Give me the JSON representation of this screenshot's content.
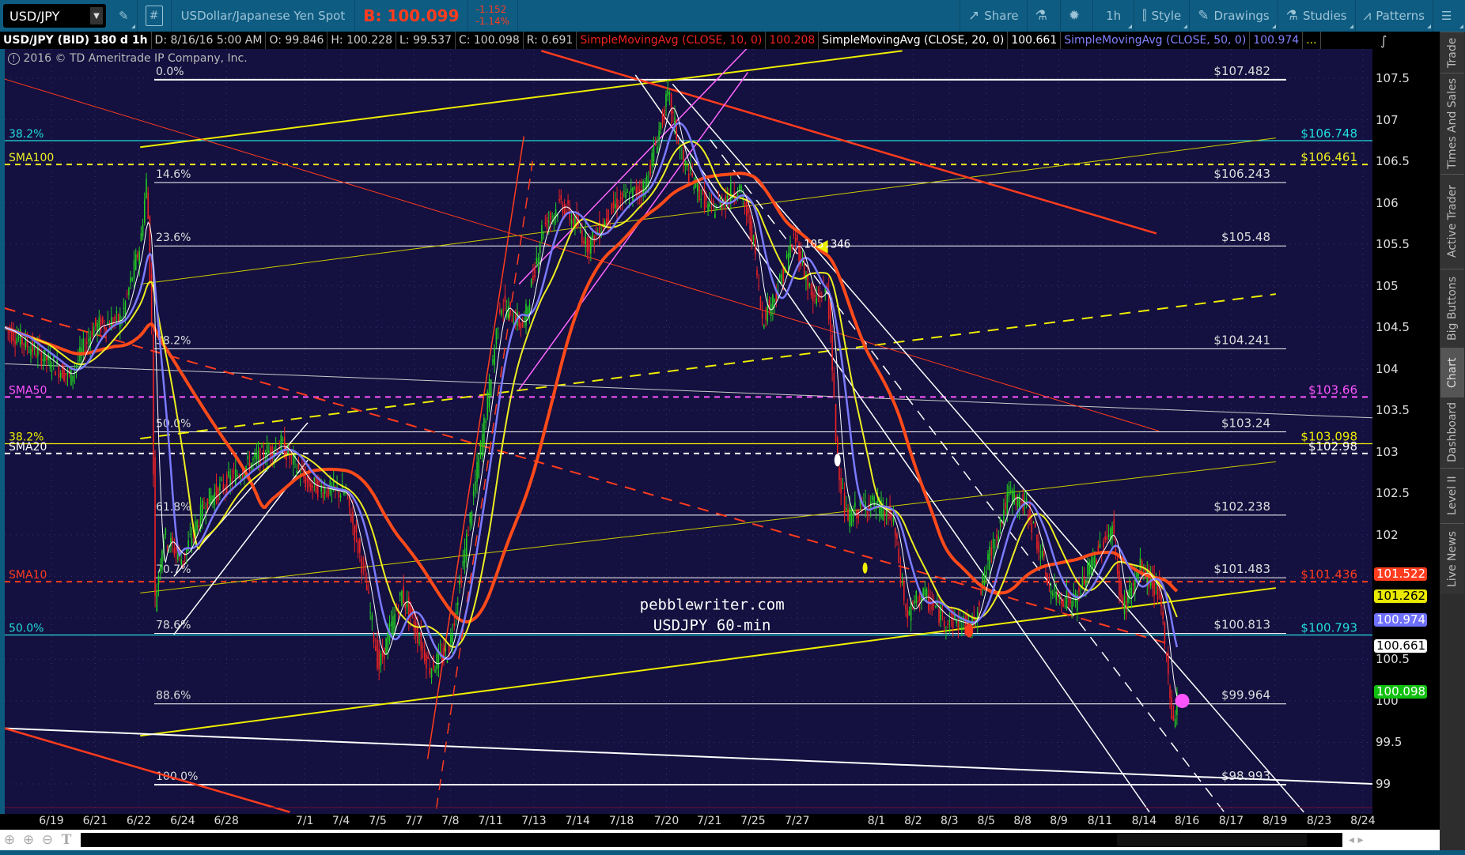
{
  "toolbar": {
    "symbol": "USD/JPY",
    "description": "USDollar/Japanese Yen Spot",
    "bid": "B: 100.099",
    "change": "-1.152",
    "change_pct": "-1.14%",
    "share": "Share",
    "interval": "1h",
    "style": "Style",
    "drawings": "Drawings",
    "studies": "Studies",
    "patterns": "Patterns"
  },
  "legend": {
    "title": "USD/JPY (BID) 180 d 1h",
    "date": "D: 8/16/16 5:00 AM",
    "open": "O: 99.846",
    "high": "H: 100.228",
    "low": "L: 99.537",
    "close": "C: 100.098",
    "range": "R: 0.691",
    "sma10": "SimpleMovingAvg (CLOSE, 10, 0)",
    "sma10_val": "100.208",
    "sma20": "SimpleMovingAvg (CLOSE, 20, 0)",
    "sma20_val": "100.661",
    "sma50": "SimpleMovingAvg (CLOSE, 50, 0)",
    "sma50_val": "100.974",
    "more": "..."
  },
  "copyright": "2016 © TD Ameritrade IP Company, Inc.",
  "annotations": {
    "site": "pebblewriter.com",
    "caption": "USDJPY 60-min",
    "peak_label": "105.346"
  },
  "sidebar_tabs": [
    "Trade",
    "Times And Sales",
    "Active Trader",
    "Big Buttons",
    "Chart",
    "Dashboard",
    "Level II",
    "Live News"
  ],
  "price_labels": [
    {
      "text": "101.522",
      "price": 101.52,
      "bg": "#ff3c1e",
      "fg": "#fff"
    },
    {
      "text": "101.262",
      "price": 101.26,
      "bg": "#e8e800",
      "fg": "#000"
    },
    {
      "text": "100.974",
      "price": 100.97,
      "bg": "#7070ff",
      "fg": "#fff"
    },
    {
      "text": "100.661",
      "price": 100.66,
      "bg": "#ffffff",
      "fg": "#000"
    },
    {
      "text": "100.098",
      "price": 100.1,
      "bg": "#10c010",
      "fg": "#fff"
    }
  ],
  "chart_data": {
    "type": "line",
    "y_ticks": [
      107.5,
      107,
      106.5,
      106,
      105.5,
      105,
      104.5,
      104,
      103.5,
      103,
      102.5,
      102,
      101.5,
      101,
      100.5,
      100,
      99.5,
      99
    ],
    "ylim": [
      98.66,
      107.85
    ],
    "x_ticks": [
      "6/19",
      "6/21",
      "6/22",
      "6/24",
      "6/28",
      "7/1",
      "7/4",
      "7/5",
      "7/7",
      "7/8",
      "7/11",
      "7/13",
      "7/14",
      "7/18",
      "7/20",
      "7/21",
      "7/25",
      "7/27",
      "8/1",
      "8/2",
      "8/3",
      "8/5",
      "8/8",
      "8/9",
      "8/11",
      "8/14",
      "8/16",
      "8/17",
      "8/19",
      "8/23",
      "8/24"
    ],
    "x_tick_pos": [
      0,
      1,
      2,
      3,
      4,
      5.79,
      6.62,
      7.46,
      8.29,
      9.12,
      10.04,
      11.03,
      12.03,
      13.03,
      14.06,
      15.04,
      16.04,
      17.05,
      18.86,
      19.7,
      20.53,
      21.37,
      22.2,
      23.03,
      23.97,
      24.98,
      25.96,
      26.97,
      27.97,
      28.98,
      29.98
    ],
    "price_series": [
      [
        -1.07,
        104.5
      ],
      [
        -0.32,
        104.2
      ],
      [
        0.43,
        103.9
      ],
      [
        0.96,
        104.5
      ],
      [
        1.6,
        104.6
      ],
      [
        2.03,
        105.5
      ],
      [
        2.18,
        106.3
      ],
      [
        2.29,
        104.5
      ],
      [
        2.37,
        101.2
      ],
      [
        2.56,
        102
      ],
      [
        2.99,
        101.7
      ],
      [
        3.53,
        102.4
      ],
      [
        4.38,
        102.8
      ],
      [
        5.24,
        103.1
      ],
      [
        5.88,
        102.6
      ],
      [
        6.73,
        102.5
      ],
      [
        7.16,
        101.5
      ],
      [
        7.48,
        100.4
      ],
      [
        8.01,
        101.3
      ],
      [
        8.65,
        100.4
      ],
      [
        9.08,
        100.6
      ],
      [
        9.51,
        102
      ],
      [
        9.94,
        103.5
      ],
      [
        10.26,
        104.8
      ],
      [
        10.79,
        104.5
      ],
      [
        11.22,
        105.7
      ],
      [
        11.65,
        106
      ],
      [
        12.29,
        105.5
      ],
      [
        12.93,
        106
      ],
      [
        13.57,
        106.2
      ],
      [
        14.1,
        107.3
      ],
      [
        14.42,
        106.5
      ],
      [
        15.06,
        105.9
      ],
      [
        15.71,
        106.2
      ],
      [
        16.03,
        105.6
      ],
      [
        16.24,
        104.6
      ],
      [
        16.56,
        104.9
      ],
      [
        16.99,
        105.6
      ],
      [
        17.41,
        104.8
      ],
      [
        17.74,
        105
      ],
      [
        17.95,
        103
      ],
      [
        18.16,
        102.2
      ],
      [
        18.7,
        102.4
      ],
      [
        19.23,
        102.2
      ],
      [
        19.55,
        101
      ],
      [
        19.87,
        101.3
      ],
      [
        20.41,
        101
      ],
      [
        21.05,
        100.9
      ],
      [
        21.47,
        101.8
      ],
      [
        21.9,
        102.5
      ],
      [
        22.33,
        102.3
      ],
      [
        22.86,
        101.3
      ],
      [
        23.4,
        101.2
      ],
      [
        23.82,
        101.7
      ],
      [
        24.25,
        102.1
      ],
      [
        24.47,
        101.1
      ],
      [
        24.89,
        101.6
      ],
      [
        25.32,
        101.3
      ],
      [
        25.53,
        100.3
      ],
      [
        25.64,
        99.7
      ],
      [
        25.75,
        100.1
      ]
    ],
    "fib_levels": [
      {
        "pct": "0.0%",
        "price": 107.482,
        "label": "$107.482"
      },
      {
        "pct": "14.6%",
        "price": 106.243,
        "label": "$106.243"
      },
      {
        "pct": "23.6%",
        "price": 105.48,
        "label": "$105.48"
      },
      {
        "pct": "38.2%",
        "price": 104.241,
        "label": "$104.241"
      },
      {
        "pct": "50.0%",
        "price": 103.24,
        "label": "$103.24"
      },
      {
        "pct": "61.8%",
        "price": 102.238,
        "label": "$102.238"
      },
      {
        "pct": "70.7%",
        "price": 101.483,
        "label": "$101.483"
      },
      {
        "pct": "78.6%",
        "price": 100.813,
        "label": "$100.813"
      },
      {
        "pct": "88.6%",
        "price": 99.964,
        "label": "$99.964"
      },
      {
        "pct": "100.0%",
        "price": 98.99,
        "label": "$98.993"
      }
    ],
    "levels": [
      {
        "name": "38.2%",
        "price": 106.748,
        "label": "$106.748",
        "color": "#22dddd",
        "dash": false
      },
      {
        "name": "SMA100",
        "price": 106.461,
        "label": "$106.461",
        "color": "#eeee22",
        "dash": true
      },
      {
        "name": "SMA50",
        "price": 103.66,
        "label": "$103.66",
        "color": "#ff55ff",
        "dash": true
      },
      {
        "name": "38.2%",
        "price": 103.098,
        "label": "$103.098",
        "color": "#eeee00",
        "dash": false
      },
      {
        "name": "SMA20",
        "price": 102.98,
        "label": "$102.98",
        "color": "#ffffff",
        "dash": true
      },
      {
        "name": "SMA10",
        "price": 101.436,
        "label": "$101.436",
        "color": "#ff3c1e",
        "dash": true
      },
      {
        "name": "50.0%",
        "price": 100.793,
        "label": "$100.793",
        "color": "#22dddd",
        "dash": false
      }
    ],
    "trendlines": [
      {
        "from": [
          2.03,
          106.67
        ],
        "to": [
          19.45,
          107.83
        ],
        "color": "#eeee00",
        "w": 2,
        "dash": false
      },
      {
        "from": [
          2.03,
          99.58
        ],
        "to": [
          27.99,
          101.36
        ],
        "color": "#eeee00",
        "w": 2,
        "dash": false
      },
      {
        "from": [
          2.03,
          103.16
        ],
        "to": [
          27.99,
          104.9
        ],
        "color": "#eeee00",
        "w": 2,
        "dash": true
      },
      {
        "from": [
          2.03,
          105.02
        ],
        "to": [
          27.99,
          106.78
        ],
        "color": "#cccc00",
        "w": 1,
        "dash": false
      },
      {
        "from": [
          2.03,
          101.3
        ],
        "to": [
          27.99,
          102.88
        ],
        "color": "#cccc00",
        "w": 1,
        "dash": false
      },
      {
        "from": [
          -1.07,
          99.67
        ],
        "to": [
          30.2,
          99.0
        ],
        "color": "#ffffff",
        "w": 2,
        "dash": false
      },
      {
        "from": [
          -1.07,
          104.06
        ],
        "to": [
          30.2,
          103.41
        ],
        "color": "#cccccc",
        "w": 1,
        "dash": false
      },
      {
        "from": [
          11.2,
          107.83
        ],
        "to": [
          25.26,
          105.63
        ],
        "color": "#ff3c1e",
        "w": 2.5,
        "dash": false
      },
      {
        "from": [
          -1.07,
          99.67
        ],
        "to": [
          5.45,
          98.66
        ],
        "color": "#ff3c1e",
        "w": 2.5,
        "dash": false
      },
      {
        "from": [
          -1.07,
          104.73
        ],
        "to": [
          25.53,
          100.69
        ],
        "color": "#ff3c1e",
        "w": 2,
        "dash": true
      },
      {
        "from": [
          -1.07,
          107.49
        ],
        "to": [
          25.32,
          103.25
        ],
        "color": "#ff3c1e",
        "w": 1,
        "dash": false
      },
      {
        "from": [
          13.35,
          107.54
        ],
        "to": [
          25.1,
          98.66
        ],
        "color": "#ffffff",
        "w": 1.5,
        "dash": false
      },
      {
        "from": [
          14.2,
          107.43
        ],
        "to": [
          28.63,
          98.66
        ],
        "color": "#ffffff",
        "w": 1.5,
        "dash": false
      },
      {
        "from": [
          15.06,
          106.76
        ],
        "to": [
          26.81,
          98.66
        ],
        "color": "#ffffff",
        "w": 1.5,
        "dash": true
      },
      {
        "from": [
          10.69,
          103.75
        ],
        "to": [
          15.92,
          107.57
        ],
        "color": "#ff66ff",
        "w": 1.5,
        "dash": false
      },
      {
        "from": [
          10.69,
          105.02
        ],
        "to": [
          15.92,
          107.87
        ],
        "color": "#ff66ff",
        "w": 1.5,
        "dash": false
      },
      {
        "from": [
          2.8,
          100.8
        ],
        "to": [
          5.86,
          102.9
        ],
        "color": "#ffffff",
        "w": 1.5,
        "dash": false
      },
      {
        "from": [
          2.8,
          101.5
        ],
        "to": [
          5.86,
          103.35
        ],
        "color": "#ffffff",
        "w": 1.5,
        "dash": false
      },
      {
        "from": [
          8.6,
          99.3
        ],
        "to": [
          10.8,
          106.8
        ],
        "color": "#ff3c1e",
        "w": 1.5,
        "dash": false
      },
      {
        "from": [
          8.8,
          98.7
        ],
        "to": [
          11.0,
          106.5
        ],
        "color": "#ff3c1e",
        "w": 1.5,
        "dash": true
      }
    ]
  },
  "bottom_icons": [
    "crosshair",
    "zoom-in",
    "zoom-out",
    "text"
  ]
}
